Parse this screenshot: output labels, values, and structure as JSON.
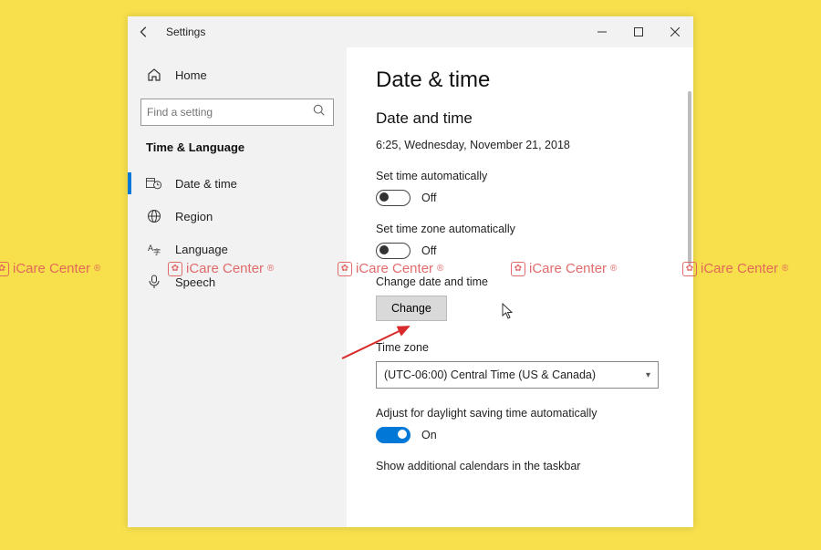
{
  "title_bar": {
    "app_name": "Settings"
  },
  "sidebar": {
    "home_label": "Home",
    "search_placeholder": "Find a setting",
    "category": "Time & Language",
    "items": [
      {
        "label": "Date & time"
      },
      {
        "label": "Region"
      },
      {
        "label": "Language"
      },
      {
        "label": "Speech"
      }
    ]
  },
  "content": {
    "page_title": "Date & time",
    "section_title": "Date and time",
    "current_datetime": "6:25, Wednesday, November 21, 2018",
    "auto_time_label": "Set time automatically",
    "auto_time_state": "Off",
    "auto_tz_label": "Set time zone automatically",
    "auto_tz_state": "Off",
    "change_label": "Change date and time",
    "change_btn": "Change",
    "tz_label": "Time zone",
    "tz_value": "(UTC-06:00) Central Time (US & Canada)",
    "dst_label": "Adjust for daylight saving time automatically",
    "dst_state": "On",
    "calendars_label": "Show additional calendars in the taskbar"
  },
  "watermark": {
    "text": "iCare Center",
    "reg": "®"
  }
}
